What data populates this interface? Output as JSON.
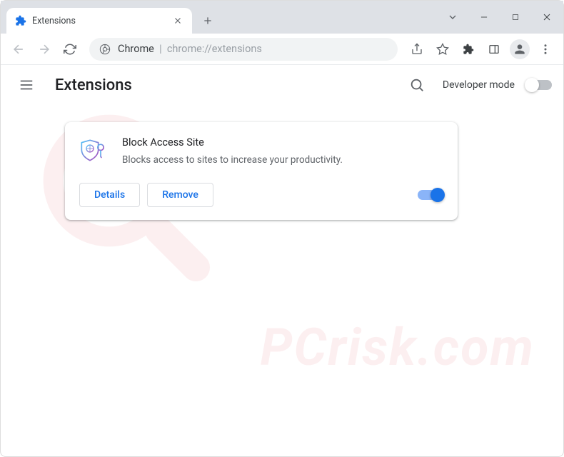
{
  "window": {
    "tab_title": "Extensions",
    "url_prefix": "Chrome",
    "url_separator": "|",
    "url_path": "chrome://extensions"
  },
  "page": {
    "title": "Extensions",
    "developer_mode_label": "Developer mode"
  },
  "extension": {
    "name": "Block Access Site",
    "description": "Blocks access to sites to increase your productivity.",
    "details_label": "Details",
    "remove_label": "Remove",
    "enabled": true
  },
  "watermark": "PCrisk.com"
}
